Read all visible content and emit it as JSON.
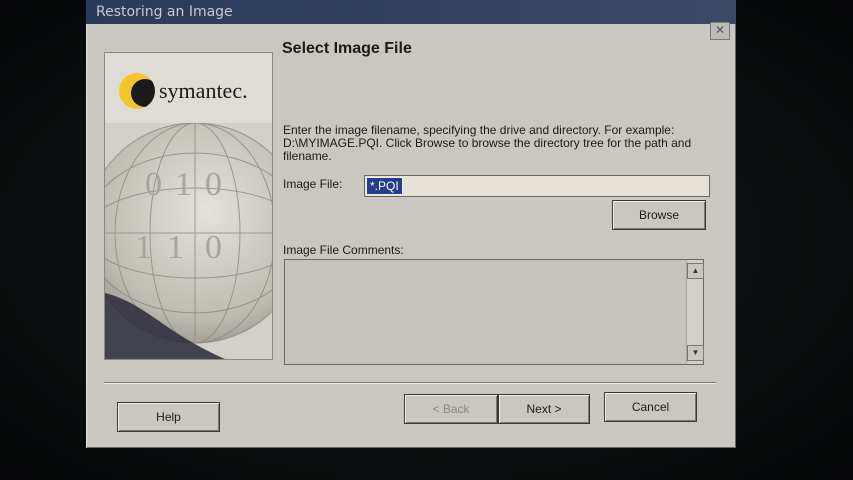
{
  "window": {
    "title": "Restoring an Image",
    "close_glyph": "✕"
  },
  "side_panel": {
    "logo_text": "symantec.",
    "logo_icon": "symantec-logo-icon",
    "art_digits": [
      "0",
      "1",
      "0",
      "1",
      "1",
      "0"
    ]
  },
  "page": {
    "heading": "Select Image File",
    "description": "Enter the image filename, specifying the drive and directory.  For example: D:\\MYIMAGE.PQI.  Click Browse to browse the directory tree for the path and filename."
  },
  "image_file": {
    "label": "Image File:",
    "value": "*.PQI"
  },
  "browse_label": "Browse",
  "comments": {
    "label": "Image File Comments:",
    "value": "",
    "scroll_up_glyph": "▲",
    "scroll_down_glyph": "▼"
  },
  "buttons": {
    "help": "Help",
    "back": "< Back",
    "next": "Next >",
    "cancel": "Cancel"
  },
  "colors": {
    "selection": "#283c8c",
    "dialog_bg": "#c9c7c0",
    "titlebar": "#2a3a5a"
  }
}
